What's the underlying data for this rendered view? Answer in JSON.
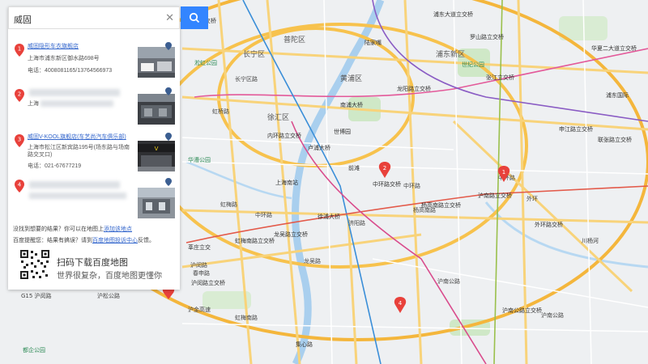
{
  "search": {
    "query": "威固"
  },
  "results": [
    {
      "index": "1",
      "name": "威固隐形车衣旗舰店",
      "address": "上海市浦东新区御水路698号",
      "tel": "电话：4008081165/13764566973"
    },
    {
      "index": "2",
      "name": "",
      "address": "上海",
      "tel": ""
    },
    {
      "index": "3",
      "name": "威固V-KOOL旗舰店(车艺尚汽车俱乐部)",
      "address": "上海市松江区新宾路195号(场东路与场南路交叉口)",
      "tel": "电话：021-67677219"
    },
    {
      "index": "4",
      "name": "",
      "address": "",
      "tel": ""
    }
  ],
  "footer": {
    "line1_prefix": "没找到想要的结果？你可以在地图上",
    "line1_link": "添加该地点",
    "line2_prefix": "百度提醒您：结果有搞误？请到",
    "line2_link": "百度地图投诉中心",
    "line2_suffix": "反馈。"
  },
  "qr": {
    "title": "扫码下载百度地图",
    "subtitle": "世界很复杂，百度地图更懂你"
  },
  "colors": {
    "accent": "#3385ff",
    "pin": "#e8413b",
    "link": "#3366cc",
    "water": "#a9cfee",
    "park": "#cfe8c7",
    "ring_road": "#f7c24d"
  },
  "map": {
    "labels": {
      "l1": "浦东新区",
      "l2": "普陀区",
      "l3": "长宁区",
      "l4": "徐汇区",
      "l5": "黄浦区",
      "l6": "上海南站",
      "l7": "中环路",
      "l8": "中环路",
      "l9": "中环路",
      "l10": "龙吴路",
      "l11": "虹梅路",
      "l12": "虹梅南路",
      "l13": "沪闵路",
      "l14": "沪金高速",
      "l15": "济阳路",
      "l16": "杨高南路",
      "l17": "外环",
      "l18": "莘庄立交",
      "l19": "龙阳路立交桥",
      "l20": "申江路立交桥",
      "l21": "华夏二大道立交桥",
      "l22": "罗山路立交桥",
      "l23": "张江立交桥",
      "l24": "联张路立交桥",
      "l25": "世纪公园",
      "l26": "陆家嘴",
      "l27": "世博园",
      "l28": "虹桥路",
      "l29": "内环路立交桥",
      "l30": "沪南路立交桥",
      "l31": "杨高南路立交桥",
      "l32": "龙吴路立交桥",
      "l33": "春申路",
      "l34": "沪闵路立交桥",
      "l35": "集心路",
      "l36": "都企公园",
      "l37": "G15 沪闵路",
      "l38": "沪松公路",
      "l39": "虹梅南路立交桥",
      "l40": "卢浦大桥",
      "l41": "南浦大桥",
      "l42": "徐浦大桥",
      "l43": "前滩",
      "l44": "淞虹公园",
      "l45": "华漕公园",
      "l46": "浦东国际",
      "l47": "沪南公路",
      "l48": "浦东大道立交桥",
      "l49": "川杨河",
      "l50": "外环路交桥",
      "l51": "沪南公路立交桥",
      "l52": "华漕立交桥",
      "l53": "长宁区路",
      "l54": "中环路交桥",
      "l55": "沪南公路"
    }
  }
}
